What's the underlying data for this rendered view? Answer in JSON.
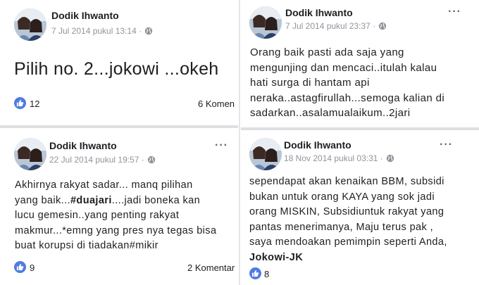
{
  "posts": [
    {
      "author": "Dodik Ihwanto",
      "time": "7 Jul 2014 pukul 13:14 · ",
      "text": "Pilih no. 2...jokowi ...okeh",
      "likes": "12",
      "comments": "6 Komen"
    },
    {
      "author": "Dodik Ihwanto",
      "time": "7 Jul 2014 pukul 23:37 · ",
      "text": "Orang baik pasti ada saja yang\nmengunjing dan mencaci..itulah kalau\nhati surga di hantam api\nneraka..astagfirullah...semoga kalian di\nsadarkan..asalamualaikum..2jari"
    },
    {
      "author": "Dodik Ihwanto",
      "time": "22 Jul 2014 pukul 19:57 · ",
      "text_a": "Akhirnya rakyat sadar... manq pilihan\nyang baik...",
      "text_b": "#duajari",
      "text_c": "....jadi boneka kan\nlucu gemesin..yang penting rakyat\nmakmur...*emng yang pres nya tegas bisa\nbuat korupsi di tiadakan#mikir",
      "likes": "9",
      "comments": "2 Komentar"
    },
    {
      "author": "Dodik Ihwanto",
      "time": "18 Nov 2014 pukul 03:31 · ",
      "text_a": "sependapat akan kenaikan BBM, subsidi\nbukan untuk orang KAYA yang sok jadi\norang MISKIN, Subsidiuntuk rakyat yang\npantas menerimanya, Maju terus pak ,\nsaya mendoakan pemimpin seperti Anda,\n",
      "text_b": "Jokowi-JK",
      "likes": "8"
    }
  ],
  "icons": {
    "like": "thumbs-up-icon",
    "privacy": "globe-icon",
    "menu": "more-options-icon"
  },
  "colors": {
    "like_blue": "#4e7ce0",
    "meta_gray": "#90949c",
    "divider": "#dddfe2"
  }
}
